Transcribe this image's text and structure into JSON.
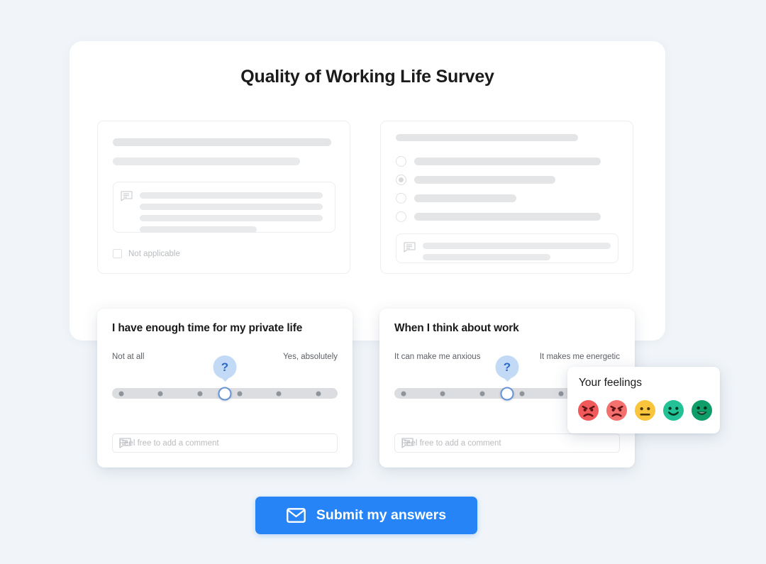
{
  "page": {
    "background_color": "#f1f5f9",
    "panel_color": "#ffffff"
  },
  "header": {
    "title": "Quality of Working Life Survey"
  },
  "skeleton_cards": [
    {
      "id": "left",
      "type": "free-text-with-comment",
      "placeholder_bars": 2,
      "comment_icon": "comment-icon",
      "comment_lines": 4,
      "checkbox": {
        "label": "Not applicable",
        "checked": false
      }
    },
    {
      "id": "right",
      "type": "multiple-choice-with-comment",
      "placeholder_bars": 1,
      "options": 4,
      "selected_option_index": 1,
      "comment_icon": "comment-icon",
      "comment_lines": 2
    }
  ],
  "slider_questions": [
    {
      "title": "I have enough time for my private life",
      "min_label": "Not at all",
      "max_label": "Yes, absolutely",
      "tooltip_badge": "?",
      "ticks": 7,
      "selected_tick": 4,
      "comment_placeholder": "Feel free to add a comment",
      "comment_icon": "comment-icon",
      "track_color": "#dcdde0",
      "thumb_border_color": "#6694d8",
      "badge_color": "#c3daf7"
    },
    {
      "title": "When I think about work",
      "min_label": "It can make me anxious",
      "max_label": "It makes me energetic",
      "tooltip_badge": "?",
      "ticks": 7,
      "selected_tick": 4,
      "comment_placeholder": "Feel free to add a comment",
      "comment_icon": "comment-icon",
      "track_color": "#dcdde0",
      "thumb_border_color": "#6694d8",
      "badge_color": "#c3daf7"
    }
  ],
  "feelings_popup": {
    "title": "Your feelings",
    "faces": [
      {
        "name": "angry-face-red",
        "mood": "angry",
        "color": "#f05a5a"
      },
      {
        "name": "angry-face-light-red",
        "mood": "angry",
        "color": "#f4706e"
      },
      {
        "name": "neutral-face-yellow",
        "mood": "neutral",
        "color": "#f9c53d"
      },
      {
        "name": "smiling-face-light-green",
        "mood": "happy",
        "color": "#22c296"
      },
      {
        "name": "grinning-face-green",
        "mood": "very-happy",
        "color": "#0f9d6a"
      }
    ]
  },
  "submit": {
    "label": "Submit my answers",
    "icon": "mail-icon",
    "color": "#2684f7",
    "text_color": "#ffffff"
  }
}
